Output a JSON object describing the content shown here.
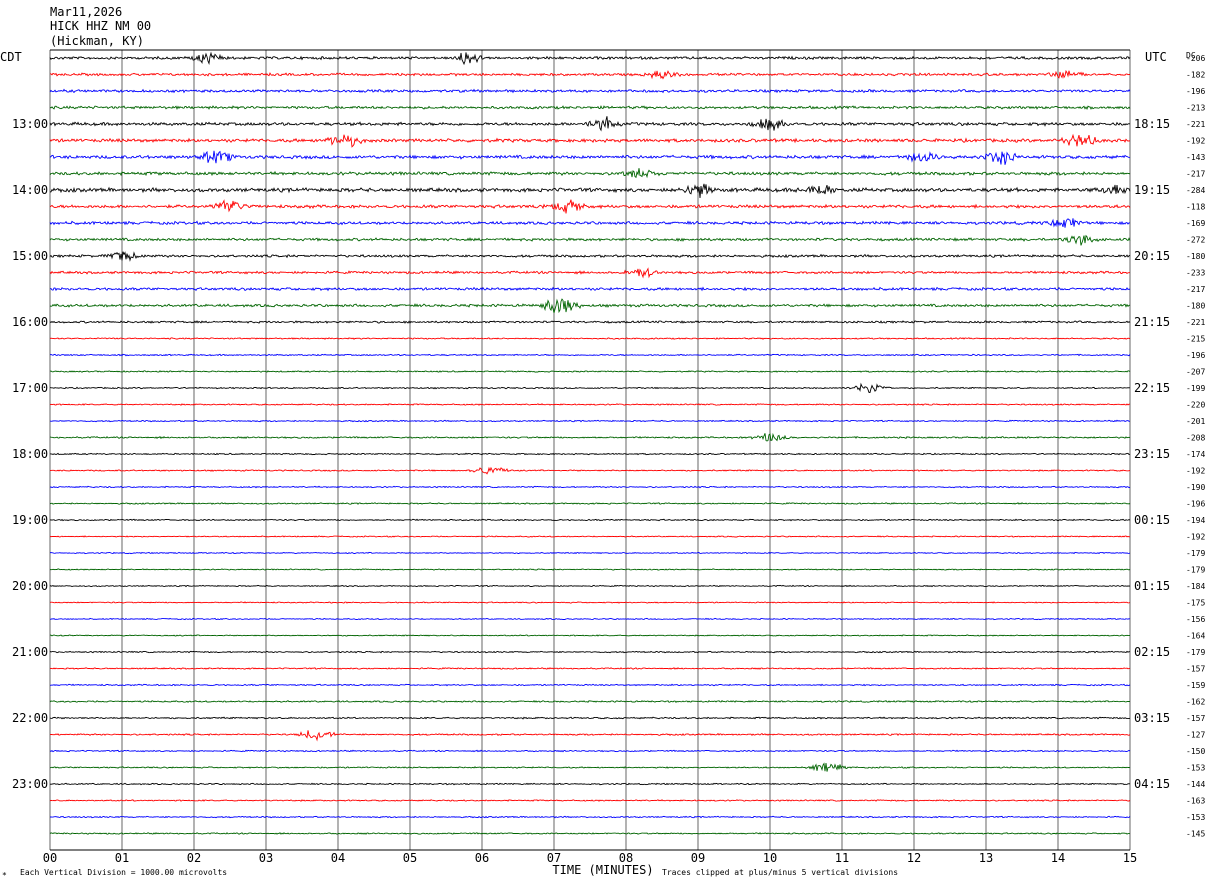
{
  "header": {
    "date": "Mar11,2026",
    "station": "HICK HHZ NM 00",
    "location": "(Hickman, KY)"
  },
  "left_axis_label": "CDT",
  "right_axis_label": "UTC",
  "dc_label": "DC",
  "footer": {
    "scale_note": "Each Vertical Division = 1000.00 microvolts",
    "clip_note": "Traces clipped at plus/minus 5 vertical divisions",
    "corner_mark": "*"
  },
  "colors": {
    "cycle": [
      "#000000",
      "#ff0000",
      "#0000ff",
      "#006400"
    ],
    "grid": "#000000"
  },
  "chart_data": {
    "type": "line",
    "xlabel": "TIME (MINUTES)",
    "xlim": [
      0,
      15
    ],
    "x_ticks": [
      "00",
      "01",
      "02",
      "03",
      "04",
      "05",
      "06",
      "07",
      "08",
      "09",
      "10",
      "11",
      "12",
      "13",
      "14",
      "15"
    ],
    "left_time_labels": [
      "13:00",
      "14:00",
      "15:00",
      "16:00",
      "17:00",
      "18:00",
      "19:00",
      "20:00",
      "21:00",
      "22:00",
      "23:00"
    ],
    "right_time_labels": [
      "18:15",
      "19:15",
      "20:15",
      "21:15",
      "22:15",
      "23:15",
      "00:15",
      "01:15",
      "02:15",
      "03:15",
      "04:15"
    ],
    "traces_per_hour": 4,
    "dc_offsets": [
      -206,
      -182,
      -196,
      -213,
      -221,
      -192,
      -143,
      -217,
      -284,
      -118,
      -169,
      -272,
      -180,
      -233,
      -217,
      -180,
      -221,
      -215,
      -196,
      -207,
      -199,
      -220,
      -201,
      -208,
      -174,
      -192,
      -190,
      -196,
      -194,
      -192,
      -179,
      -179,
      -184,
      -175,
      -156,
      -164,
      -179,
      -157,
      -159,
      -162,
      -157,
      -127,
      -150,
      -153,
      -144,
      -163,
      -153,
      -145
    ],
    "trace_amplitude": [
      0.6,
      0.55,
      0.6,
      0.6,
      0.7,
      0.75,
      0.75,
      0.7,
      0.85,
      0.7,
      0.65,
      0.6,
      0.55,
      0.55,
      0.6,
      0.6,
      0.45,
      0.3,
      0.3,
      0.3,
      0.3,
      0.3,
      0.3,
      0.35,
      0.3,
      0.3,
      0.3,
      0.3,
      0.3,
      0.25,
      0.25,
      0.25,
      0.25,
      0.25,
      0.25,
      0.25,
      0.3,
      0.3,
      0.3,
      0.35,
      0.35,
      0.35,
      0.3,
      0.3,
      0.3,
      0.3,
      0.3,
      0.3
    ],
    "events": [
      {
        "trace": 0,
        "minute": 2.2,
        "amp": 1.3
      },
      {
        "trace": 0,
        "minute": 5.8,
        "amp": 1.4
      },
      {
        "trace": 1,
        "minute": 8.5,
        "amp": 1.2
      },
      {
        "trace": 1,
        "minute": 14.1,
        "amp": 1.3
      },
      {
        "trace": 4,
        "minute": 7.7,
        "amp": 1.8
      },
      {
        "trace": 4,
        "minute": 10.0,
        "amp": 1.6
      },
      {
        "trace": 5,
        "minute": 4.1,
        "amp": 1.8
      },
      {
        "trace": 5,
        "minute": 14.3,
        "amp": 1.8
      },
      {
        "trace": 6,
        "minute": 2.3,
        "amp": 1.7
      },
      {
        "trace": 6,
        "minute": 12.1,
        "amp": 1.6
      },
      {
        "trace": 6,
        "minute": 13.2,
        "amp": 1.8
      },
      {
        "trace": 7,
        "minute": 8.2,
        "amp": 1.4
      },
      {
        "trace": 8,
        "minute": 9.0,
        "amp": 2.0
      },
      {
        "trace": 8,
        "minute": 10.7,
        "amp": 1.6
      },
      {
        "trace": 8,
        "minute": 14.8,
        "amp": 1.5
      },
      {
        "trace": 9,
        "minute": 2.5,
        "amp": 1.8
      },
      {
        "trace": 9,
        "minute": 7.2,
        "amp": 1.6
      },
      {
        "trace": 10,
        "minute": 14.1,
        "amp": 1.4
      },
      {
        "trace": 11,
        "minute": 14.3,
        "amp": 1.4
      },
      {
        "trace": 12,
        "minute": 1.0,
        "amp": 1.2
      },
      {
        "trace": 13,
        "minute": 8.2,
        "amp": 1.3
      },
      {
        "trace": 15,
        "minute": 7.1,
        "amp": 2.3
      },
      {
        "trace": 20,
        "minute": 11.4,
        "amp": 1.4
      },
      {
        "trace": 23,
        "minute": 10.0,
        "amp": 1.1
      },
      {
        "trace": 25,
        "minute": 6.1,
        "amp": 1.2
      },
      {
        "trace": 41,
        "minute": 3.7,
        "amp": 1.3
      },
      {
        "trace": 43,
        "minute": 10.8,
        "amp": 1.2
      }
    ]
  }
}
